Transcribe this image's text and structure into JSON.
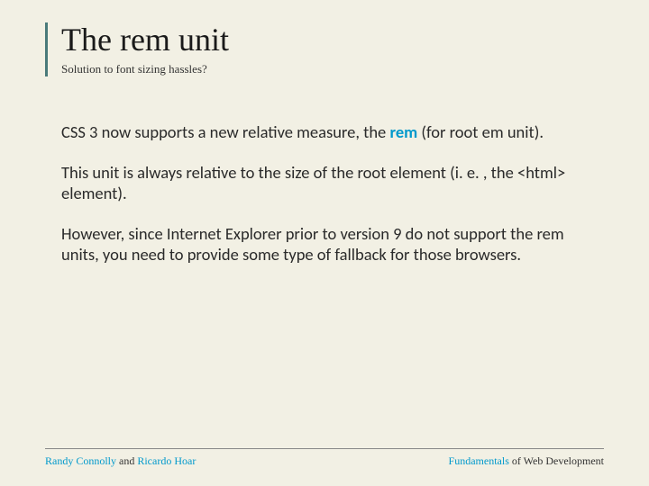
{
  "header": {
    "title": "The rem unit",
    "subtitle": "Solution to font sizing hassles?"
  },
  "body": {
    "p1_a": "CSS 3 now supports a new relative measure, the ",
    "p1_highlight": "rem",
    "p1_b": " (for root em unit).",
    "p2": "This unit is always relative to the size of the root element (i. e. , the <html> element).",
    "p3": "However, since Internet Explorer prior to version 9 do not support the rem units, you need to provide some type of fallback for those browsers."
  },
  "footer": {
    "author1": "Randy Connolly",
    "and": " and ",
    "author2": "Ricardo Hoar",
    "book_a": "Fundamentals",
    "book_b": " of Web Development"
  }
}
